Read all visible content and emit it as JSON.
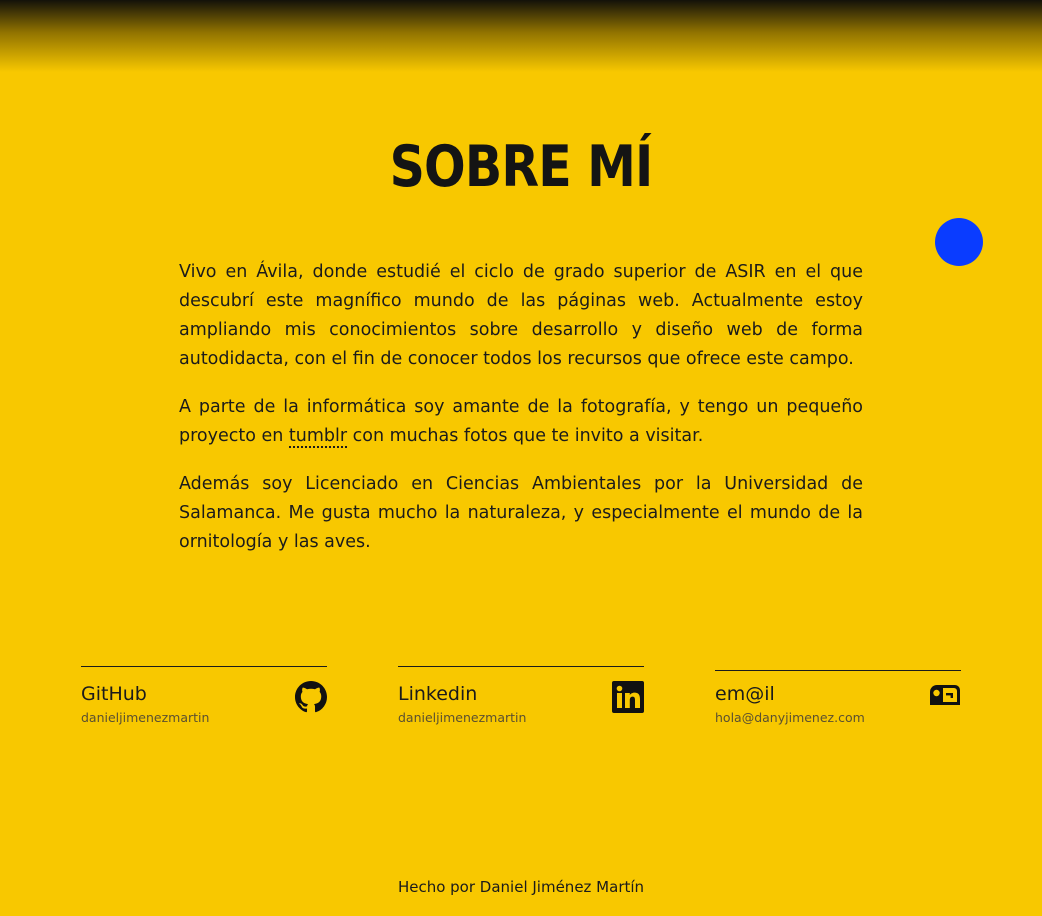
{
  "header": {
    "title": "SOBRE MÍ"
  },
  "about": {
    "p1": "Vivo en Ávila, donde estudié el ciclo de grado superior de ASIR en el que descubrí este magnífico mundo de las páginas web. Actualmente estoy ampliando mis conocimientos sobre desarrollo y diseño web de forma autodidacta, con el fin de conocer todos los recursos que ofrece este campo.",
    "p2_before": "A parte de la informática soy amante de la fotografía, y tengo un pe­queño proyecto en ",
    "p2_link": "tumblr",
    "p2_after": " con muchas fotos que te invito a visitar.",
    "p3": "Además soy Licenciado en Ciencias Ambientales por la Universidad de Salamanca. Me gusta mucho la naturaleza, y especialmente el mundo de la ornitología y las aves."
  },
  "contacts": [
    {
      "label": "GitHub",
      "handle": "danieljimenezmartin",
      "icon": "github-icon"
    },
    {
      "label": "Linkedin",
      "handle": "danieljimenezmartin",
      "icon": "linkedin-icon"
    },
    {
      "label": "em@il",
      "handle": "hola@danyjimenez.com",
      "icon": "mailbox-icon"
    }
  ],
  "footer": {
    "text": "Hecho por Daniel Jiménez Martín"
  },
  "colors": {
    "background": "#f8c800",
    "accent_dot": "#0a3cff",
    "text": "#1b1b1b"
  }
}
